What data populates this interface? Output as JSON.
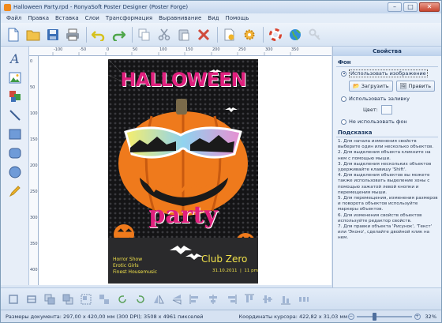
{
  "window": {
    "title": "Halloween Party.rpd - RonyaSoft Poster Designer (Poster Forge)",
    "buttons": {
      "minimize": "–",
      "maximize": "□",
      "close": "✕"
    }
  },
  "menu": [
    "Файл",
    "Правка",
    "Вставка",
    "Слои",
    "Трансформация",
    "Выравнивание",
    "Вид",
    "Помощь"
  ],
  "toolbar": {
    "icons": [
      "new-document-icon",
      "open-folder-icon",
      "save-icon",
      "print-icon",
      "undo-icon",
      "redo-icon",
      "copy-icon",
      "cut-icon",
      "paste-icon",
      "delete-icon",
      "document-properties-icon",
      "settings-gear-icon",
      "help-lifebuoy-icon",
      "web-globe-icon",
      "register-key-icon"
    ]
  },
  "left_tools": [
    "text-tool-icon",
    "image-tool-icon",
    "clipart-tool-icon",
    "line-tool-icon",
    "rectangle-tool-icon",
    "rounded-rectangle-tool-icon",
    "ellipse-tool-icon",
    "pencil-tool-icon"
  ],
  "ruler": {
    "top": [
      "-100",
      "-50",
      "0",
      "50",
      "100",
      "150",
      "200",
      "250",
      "300",
      "350"
    ],
    "left": [
      "0",
      "50",
      "100",
      "150",
      "200",
      "250",
      "300",
      "350",
      "400"
    ]
  },
  "poster": {
    "title_line1": "HALLOWEEN",
    "title_line2": "party",
    "left_lines": [
      "Horror Show",
      "Erotic Girls",
      "Finest Housemusic"
    ],
    "club": "Club Zero",
    "date": "31.10.2011  |  11 pm",
    "colors": {
      "background": "#141416",
      "pink": "#e0207e",
      "pumpkin": "#ef7a1c",
      "text": "#f0e14a"
    }
  },
  "panel": {
    "header": "Свойства",
    "background_section": "Фон",
    "use_image": "Использовать изображение",
    "load_button": "Загрузить",
    "edit_button": "Править",
    "use_fill": "Использовать заливку",
    "color_label": "Цвет:",
    "no_background": "Не использовать фон",
    "hint_section": "Подсказка",
    "hints": [
      "1. Для начала изменения свойств выберите один или несколько объектов.",
      "2. Для выделения объекта кликните на нем с помощью мыши.",
      "3. Для выделения нескольких объектов удерживайте клавишу 'Shift'.",
      "4. Для выделения объектов вы можете также использовать выделение зоны с помощью зажатой левой кнопки и перемещения мыши.",
      "5. Для перемещения, изменения размеров и поворота объектов используйте маркеры объектов.",
      "6. Для изменения свойств объектов используйте редактор свойств.",
      "7. Для правки объекта 'Рисунок', 'Текст' или 'Эконо', сделайте двойной клик на нем."
    ]
  },
  "bottom_tools": [
    "fit-page-icon",
    "fit-width-icon",
    "bring-front-icon",
    "send-back-icon",
    "group-icon",
    "ungroup-icon",
    "rotate-left-icon",
    "rotate-right-icon",
    "flip-horizontal-icon",
    "flip-vertical-icon",
    "align-left-icon",
    "align-center-icon",
    "align-right-icon",
    "align-top-icon",
    "align-middle-icon",
    "align-bottom-icon",
    "distribute-icon"
  ],
  "status": {
    "doc_size": "Размеры документа: 297,00 x 420,00 мм (300 DPI); 3508 x 4961 пикселей",
    "cursor": "Координаты курсора: 422,82 x 31,03 мм",
    "zoom": "32%",
    "zoom_fraction": 0.32
  }
}
